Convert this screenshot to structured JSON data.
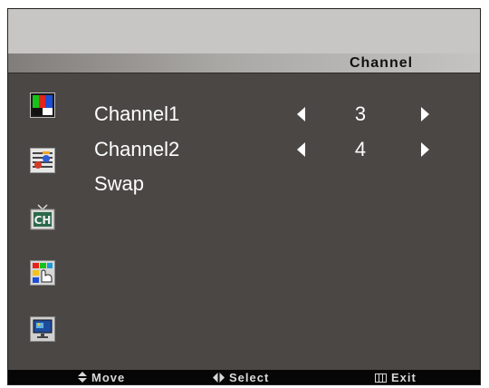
{
  "menu": {
    "title": "Channel",
    "icons": [
      "picture-icon",
      "audio-icon",
      "channel-tv-icon",
      "feature-hand-icon",
      "screen-setup-icon"
    ]
  },
  "items": [
    {
      "label": "Channel1",
      "value": "3"
    },
    {
      "label": "Channel2",
      "value": "4"
    },
    {
      "label": "Swap"
    }
  ],
  "footer": {
    "move": "Move",
    "select": "Select",
    "exit": "Exit"
  },
  "colors": {
    "panel": "#4a4744",
    "title_bar": "#b9b7b5",
    "text": "#ffffff",
    "footer": "#060606"
  }
}
